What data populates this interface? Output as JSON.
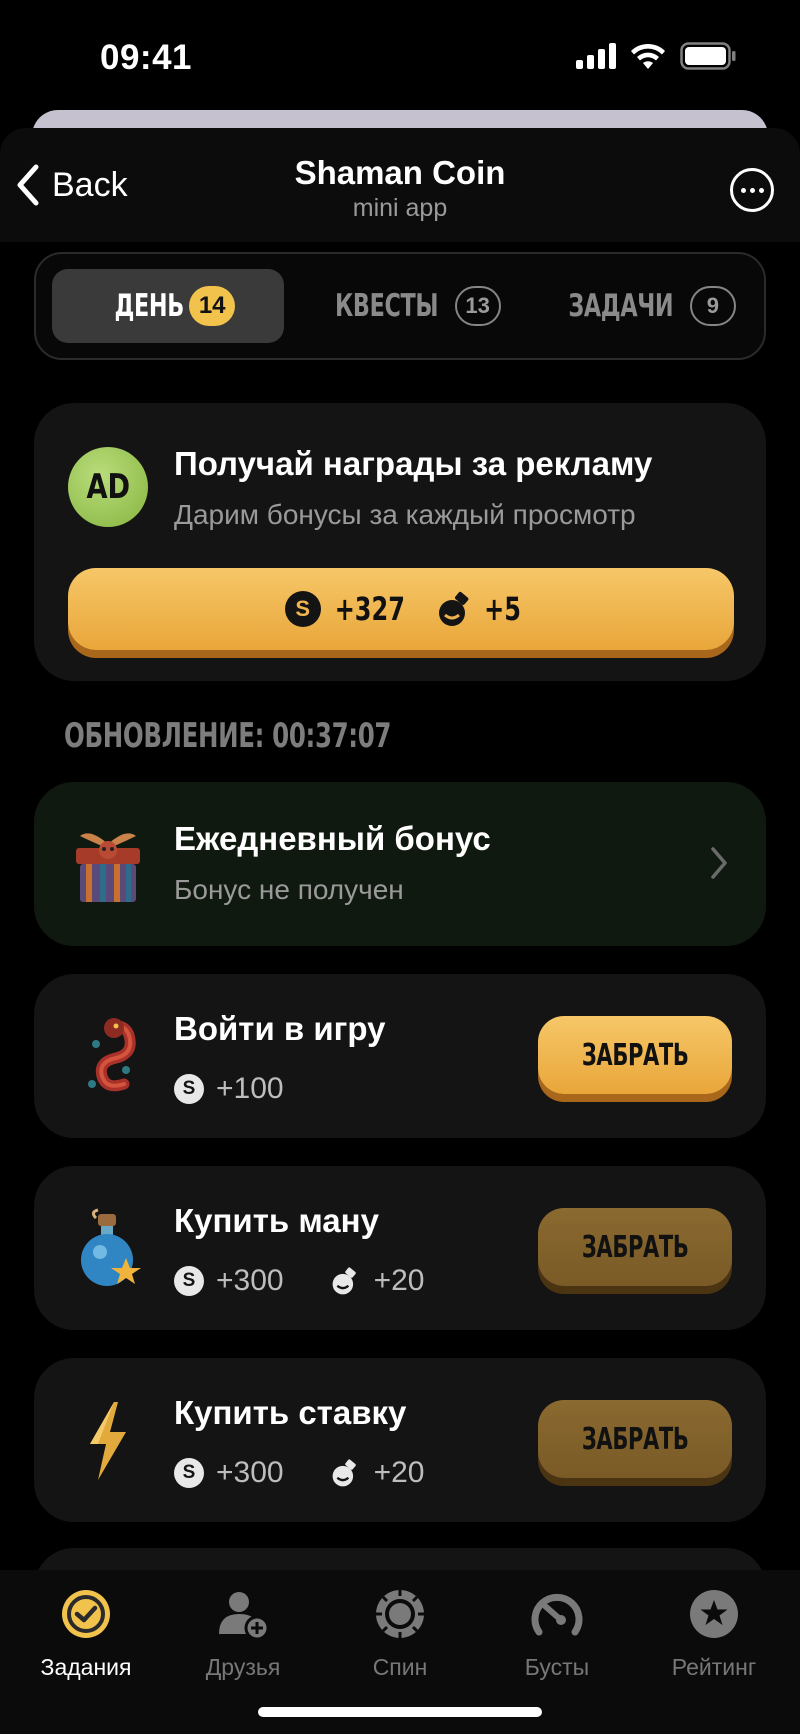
{
  "status_bar": {
    "time": "09:41"
  },
  "header": {
    "back_label": "Back",
    "title": "Shaman Coin",
    "subtitle": "mini app"
  },
  "tabs": [
    {
      "label": "ДЕНЬ",
      "badge": "14",
      "active": true
    },
    {
      "label": "КВЕСТЫ",
      "badge": "13",
      "active": false
    },
    {
      "label": "ЗАДАЧИ",
      "badge": "9",
      "active": false
    }
  ],
  "ad_card": {
    "icon_text": "AD",
    "title": "Получай награды за рекламу",
    "subtitle": "Дарим бонусы за каждый просмотр",
    "coin_symbol": "S",
    "coin_amount": "+327",
    "potion_amount": "+5"
  },
  "refresh": {
    "label": "ОБНОВЛЕНИЕ: 00:37:07"
  },
  "daily_bonus": {
    "title": "Ежедневный бонус",
    "subtitle": "Бонус не получен"
  },
  "tasks": [
    {
      "title": "Войти в игру",
      "coins": "+100",
      "potions": null,
      "button": "ЗАБРАТЬ",
      "button_state": "active",
      "icon": "dragon-icon"
    },
    {
      "title": "Купить ману",
      "coins": "+300",
      "potions": "+20",
      "button": "ЗАБРАТЬ",
      "button_state": "dim",
      "icon": "potion-icon"
    },
    {
      "title": "Купить ставку",
      "coins": "+300",
      "potions": "+20",
      "button": "ЗАБРАТЬ",
      "button_state": "dim",
      "icon": "lightning-icon"
    }
  ],
  "bottom_nav": [
    {
      "label": "Задания",
      "icon": "check-circle-icon",
      "active": true
    },
    {
      "label": "Друзья",
      "icon": "friends-icon",
      "active": false
    },
    {
      "label": "Спин",
      "icon": "spin-icon",
      "active": false
    },
    {
      "label": "Бусты",
      "icon": "speedometer-icon",
      "active": false
    },
    {
      "label": "Рейтинг",
      "icon": "star-badge-icon",
      "active": false
    }
  ],
  "colors": {
    "accent": "#f1c24c",
    "button_active": "#eeb14e",
    "button_dim": "#82622c",
    "card_bg": "#141414",
    "daily_bg": "#10190f"
  }
}
